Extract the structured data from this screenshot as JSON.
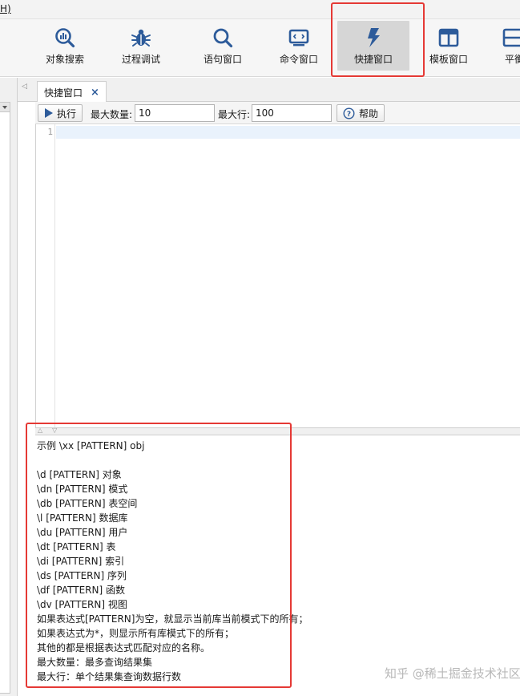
{
  "menubar": {
    "fragment": "H)"
  },
  "toolbar": {
    "items": [
      {
        "label": "",
        "icon": "partial-icon"
      },
      {
        "label": "对象搜索",
        "icon": "chart-search-icon"
      },
      {
        "label": "过程调试",
        "icon": "bug-icon"
      },
      {
        "label": "语句窗口",
        "icon": "search-icon"
      },
      {
        "label": "命令窗口",
        "icon": "terminal-icon"
      },
      {
        "label": "快捷窗口",
        "icon": "lightning-icon",
        "active": true
      },
      {
        "label": "模板窗口",
        "icon": "template-icon"
      },
      {
        "label": "平衡",
        "icon": "partial-icon"
      }
    ]
  },
  "tabs": [
    {
      "label": "快捷窗口",
      "close": "×"
    }
  ],
  "command_row": {
    "execute_label": "执行",
    "max_count_label": "最大数量:",
    "max_count_value": "10",
    "max_rows_label": "最大行:",
    "max_rows_value": "100",
    "help_label": "帮助"
  },
  "editor": {
    "line_numbers": [
      "1"
    ]
  },
  "help_lines": [
    "示例 \\xx [PATTERN] obj",
    "",
    "\\d  [PATTERN] 对象",
    "\\dn [PATTERN] 模式",
    "\\db [PATTERN] 表空间",
    "\\l  [PATTERN] 数据库",
    "\\du [PATTERN] 用户",
    "\\dt [PATTERN] 表",
    "\\di [PATTERN] 索引",
    "\\ds [PATTERN] 序列",
    "\\df [PATTERN] 函数",
    "\\dv [PATTERN] 视图",
    "如果表达式[PATTERN]为空，就显示当前库当前模式下的所有；",
    "如果表达式为*，则显示所有库模式下的所有；",
    "其他的都是根据表达式匹配对应的名称。",
    "最大数量：最多查询结果集",
    "最大行：单个结果集查询数据行数"
  ],
  "watermark": "知乎 @稀土掘金技术社区",
  "colors": {
    "highlight": "#e53935",
    "icon_blue": "#2d5b9a",
    "current_line": "#e9f2fc"
  }
}
